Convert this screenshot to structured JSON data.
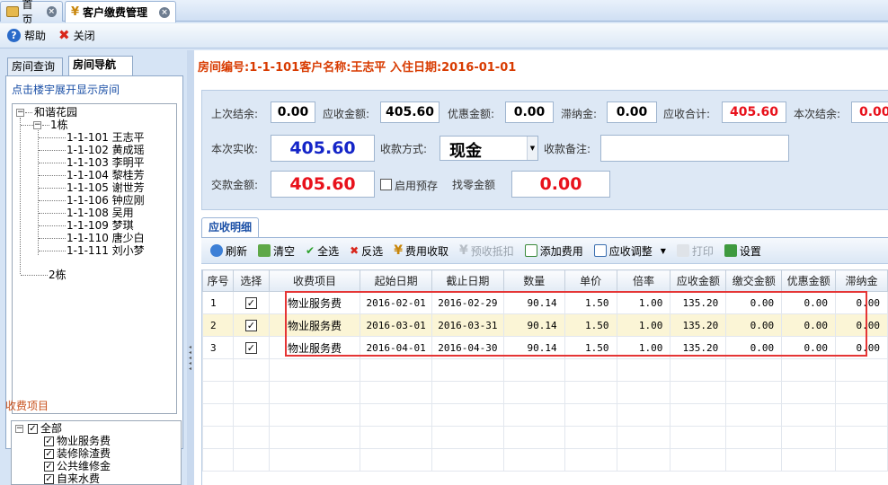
{
  "tabs": [
    {
      "label": "首页"
    },
    {
      "label": "客户缴费管理"
    }
  ],
  "commands": {
    "help": "帮助",
    "close": "关闭"
  },
  "left": {
    "tab_room_query": "房间查询",
    "tab_room_nav": "房间导航",
    "hint": "点击楼宇展开显示房间",
    "tree": {
      "root": "和谐花园",
      "building1": "1栋",
      "rooms": [
        "1-1-101 王志平",
        "1-1-102 黄成瑶",
        "1-1-103 李明平",
        "1-1-104 黎桂芳",
        "1-1-105 谢世芳",
        "1-1-106 钟应刚",
        "1-1-108 吴用",
        "1-1-109 梦琪",
        "1-1-110 唐少白",
        "1-1-111 刘小梦"
      ],
      "building2": "2栋"
    },
    "fee_title": "收费项目",
    "fee_items": [
      "全部",
      "物业服务费",
      "装修除渣费",
      "公共维修金",
      "自来水费"
    ]
  },
  "info": {
    "text": "房间编号:1-1-101客户名称:王志平 入住日期:2016-01-01"
  },
  "form": {
    "last_balance_label": "上次结余:",
    "last_balance": "0.00",
    "receivable_label": "应收金额:",
    "receivable": "405.60",
    "discount_label": "优惠金额:",
    "discount": "0.00",
    "late_fee_label": "滞纳金:",
    "late_fee": "0.00",
    "total_label": "应收合计:",
    "total": "405.60",
    "this_balance_label": "本次结余:",
    "this_balance": "0.00",
    "actual_label": "本次实收:",
    "actual": "405.60",
    "method_label": "收款方式:",
    "method": "现金",
    "remark_label": "收款备注:",
    "remark": "",
    "paid_label": "交款金额:",
    "paid": "405.60",
    "prepay_label": "启用预存",
    "change_label": "找零金额",
    "change": "0.00"
  },
  "detail": {
    "tab": "应收明细",
    "toolbar": [
      "刷新",
      "清空",
      "全选",
      "反选",
      "费用收取",
      "预收抵扣",
      "添加费用",
      "应收调整",
      "打印",
      "设置"
    ],
    "columns": [
      "序号",
      "选择",
      "收费项目",
      "起始日期",
      "截止日期",
      "数量",
      "单价",
      "倍率",
      "应收金额",
      "缴交金额",
      "优惠金额",
      "滞纳金"
    ],
    "rows": [
      {
        "idx": "1",
        "item": "物业服务费",
        "start": "2016-02-01",
        "end": "2016-02-29",
        "qty": "90.14",
        "price": "1.50",
        "rate": "1.00",
        "amount": "135.20",
        "paid": "0.00",
        "discount": "0.00",
        "late": "0.00"
      },
      {
        "idx": "2",
        "item": "物业服务费",
        "start": "2016-03-01",
        "end": "2016-03-31",
        "qty": "90.14",
        "price": "1.50",
        "rate": "1.00",
        "amount": "135.20",
        "paid": "0.00",
        "discount": "0.00",
        "late": "0.00"
      },
      {
        "idx": "3",
        "item": "物业服务费",
        "start": "2016-04-01",
        "end": "2016-04-30",
        "qty": "90.14",
        "price": "1.50",
        "rate": "1.00",
        "amount": "135.20",
        "paid": "0.00",
        "discount": "0.00",
        "late": "0.00"
      }
    ]
  }
}
